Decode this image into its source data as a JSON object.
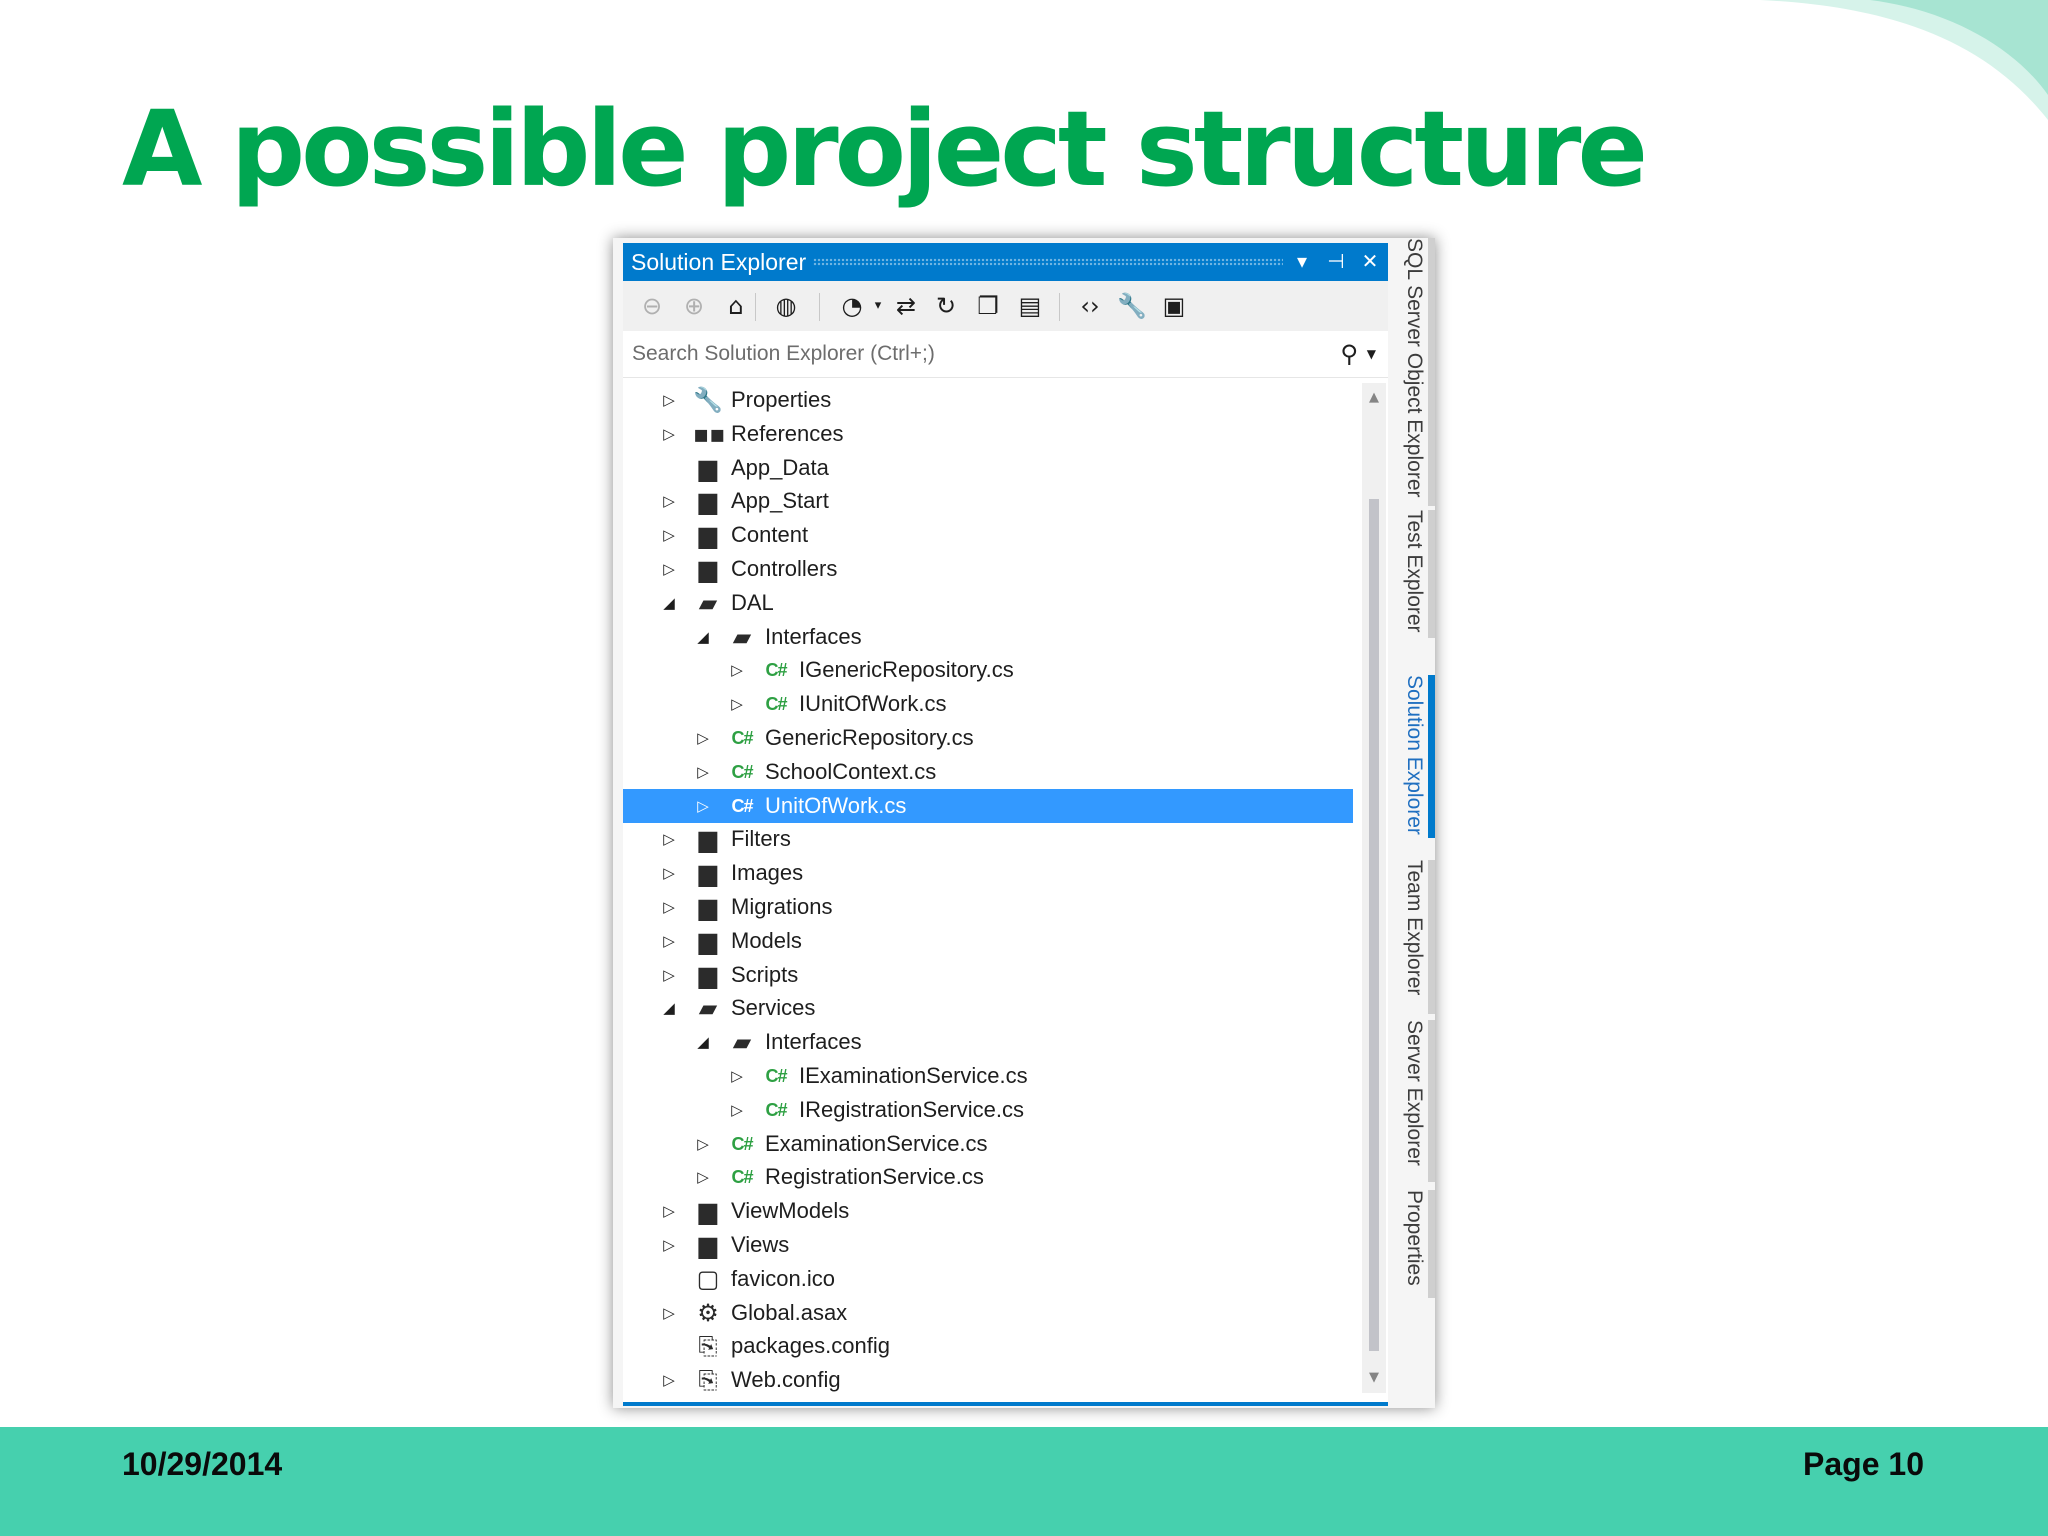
{
  "slide": {
    "title": "A possible project structure",
    "date": "10/29/2014",
    "page": "Page 10",
    "accent_color": "#00a651",
    "footer_color": "#46d0ae"
  },
  "panel": {
    "title": "Solution Explorer",
    "controls": {
      "dropdown": "▾",
      "pin": "⊣",
      "close": "✕"
    },
    "search_placeholder": "Search Solution Explorer (Ctrl+;)",
    "accent_color": "#007acc",
    "selection_color": "#3399ff",
    "toolbar": [
      {
        "name": "back-icon",
        "glyph": "⊖",
        "disabled": true
      },
      {
        "name": "forward-icon",
        "glyph": "⊕",
        "disabled": true
      },
      {
        "name": "home-icon",
        "glyph": "⌂",
        "disabled": false
      },
      {
        "name": "globe-icon",
        "glyph": "◍",
        "disabled": false
      },
      {
        "name": "pending-changes-icon",
        "glyph": "◔",
        "disabled": false
      },
      {
        "name": "sync-icon",
        "glyph": "⇄",
        "disabled": false
      },
      {
        "name": "refresh-icon",
        "glyph": "↻",
        "disabled": false
      },
      {
        "name": "collapse-all-icon",
        "glyph": "❐",
        "disabled": false
      },
      {
        "name": "show-all-files-icon",
        "glyph": "▤",
        "disabled": false
      },
      {
        "name": "view-code-icon",
        "glyph": "‹›",
        "disabled": false
      },
      {
        "name": "properties-icon",
        "glyph": "🔧",
        "disabled": false
      },
      {
        "name": "preview-icon",
        "glyph": "▣",
        "disabled": false
      }
    ],
    "tree": [
      {
        "label": "Properties",
        "indent": 0,
        "expander": "collapsed",
        "icon": "wrench"
      },
      {
        "label": "References",
        "indent": 0,
        "expander": "collapsed",
        "icon": "references"
      },
      {
        "label": "App_Data",
        "indent": 0,
        "expander": "none",
        "icon": "folder"
      },
      {
        "label": "App_Start",
        "indent": 0,
        "expander": "collapsed",
        "icon": "folder"
      },
      {
        "label": "Content",
        "indent": 0,
        "expander": "collapsed",
        "icon": "folder"
      },
      {
        "label": "Controllers",
        "indent": 0,
        "expander": "collapsed",
        "icon": "folder"
      },
      {
        "label": "DAL",
        "indent": 0,
        "expander": "expanded",
        "icon": "folder-open"
      },
      {
        "label": "Interfaces",
        "indent": 1,
        "expander": "expanded",
        "icon": "folder-open"
      },
      {
        "label": "IGenericRepository.cs",
        "indent": 2,
        "expander": "collapsed",
        "icon": "csharp"
      },
      {
        "label": "IUnitOfWork.cs",
        "indent": 2,
        "expander": "collapsed",
        "icon": "csharp"
      },
      {
        "label": "GenericRepository.cs",
        "indent": 1,
        "expander": "collapsed",
        "icon": "csharp"
      },
      {
        "label": "SchoolContext.cs",
        "indent": 1,
        "expander": "collapsed",
        "icon": "csharp"
      },
      {
        "label": "UnitOfWork.cs",
        "indent": 1,
        "expander": "collapsed",
        "icon": "csharp",
        "selected": true
      },
      {
        "label": "Filters",
        "indent": 0,
        "expander": "collapsed",
        "icon": "folder"
      },
      {
        "label": "Images",
        "indent": 0,
        "expander": "collapsed",
        "icon": "folder"
      },
      {
        "label": "Migrations",
        "indent": 0,
        "expander": "collapsed",
        "icon": "folder"
      },
      {
        "label": "Models",
        "indent": 0,
        "expander": "collapsed",
        "icon": "folder"
      },
      {
        "label": "Scripts",
        "indent": 0,
        "expander": "collapsed",
        "icon": "folder"
      },
      {
        "label": "Services",
        "indent": 0,
        "expander": "expanded",
        "icon": "folder-open"
      },
      {
        "label": "Interfaces",
        "indent": 1,
        "expander": "expanded",
        "icon": "folder-open"
      },
      {
        "label": "IExaminationService.cs",
        "indent": 2,
        "expander": "collapsed",
        "icon": "csharp"
      },
      {
        "label": "IRegistrationService.cs",
        "indent": 2,
        "expander": "collapsed",
        "icon": "csharp"
      },
      {
        "label": "ExaminationService.cs",
        "indent": 1,
        "expander": "collapsed",
        "icon": "csharp"
      },
      {
        "label": "RegistrationService.cs",
        "indent": 1,
        "expander": "collapsed",
        "icon": "csharp"
      },
      {
        "label": "ViewModels",
        "indent": 0,
        "expander": "collapsed",
        "icon": "folder"
      },
      {
        "label": "Views",
        "indent": 0,
        "expander": "collapsed",
        "icon": "folder"
      },
      {
        "label": "favicon.ico",
        "indent": 0,
        "expander": "none",
        "icon": "file"
      },
      {
        "label": "Global.asax",
        "indent": 0,
        "expander": "collapsed",
        "icon": "config-gear"
      },
      {
        "label": "packages.config",
        "indent": 0,
        "expander": "none",
        "icon": "config"
      },
      {
        "label": "Web.config",
        "indent": 0,
        "expander": "collapsed",
        "icon": "config"
      }
    ]
  },
  "side_tabs": [
    {
      "label": "SQL Server Object Explorer",
      "active": false
    },
    {
      "label": "Test Explorer",
      "active": false
    },
    {
      "label": "Solution Explorer",
      "active": true
    },
    {
      "label": "Team Explorer",
      "active": false
    },
    {
      "label": "Server Explorer",
      "active": false
    },
    {
      "label": "Properties",
      "active": false
    }
  ]
}
